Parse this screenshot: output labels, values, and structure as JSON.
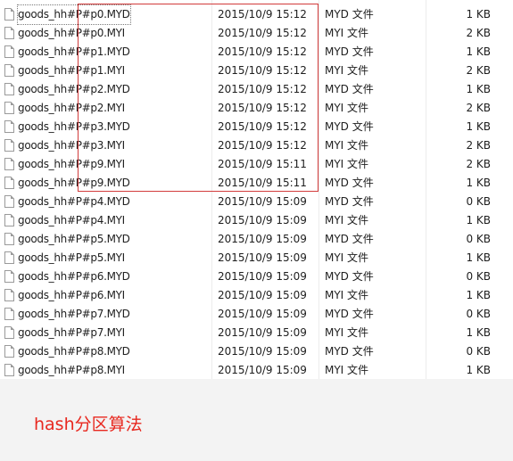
{
  "files": [
    {
      "name": "goods_hh#P#p0.MYD",
      "date": "2015/10/9 15:12",
      "type": "MYD 文件",
      "size": "1 KB"
    },
    {
      "name": "goods_hh#P#p0.MYI",
      "date": "2015/10/9 15:12",
      "type": "MYI 文件",
      "size": "2 KB"
    },
    {
      "name": "goods_hh#P#p1.MYD",
      "date": "2015/10/9 15:12",
      "type": "MYD 文件",
      "size": "1 KB"
    },
    {
      "name": "goods_hh#P#p1.MYI",
      "date": "2015/10/9 15:12",
      "type": "MYI 文件",
      "size": "2 KB"
    },
    {
      "name": "goods_hh#P#p2.MYD",
      "date": "2015/10/9 15:12",
      "type": "MYD 文件",
      "size": "1 KB"
    },
    {
      "name": "goods_hh#P#p2.MYI",
      "date": "2015/10/9 15:12",
      "type": "MYI 文件",
      "size": "2 KB"
    },
    {
      "name": "goods_hh#P#p3.MYD",
      "date": "2015/10/9 15:12",
      "type": "MYD 文件",
      "size": "1 KB"
    },
    {
      "name": "goods_hh#P#p3.MYI",
      "date": "2015/10/9 15:12",
      "type": "MYI 文件",
      "size": "2 KB"
    },
    {
      "name": "goods_hh#P#p9.MYI",
      "date": "2015/10/9 15:11",
      "type": "MYI 文件",
      "size": "2 KB"
    },
    {
      "name": "goods_hh#P#p9.MYD",
      "date": "2015/10/9 15:11",
      "type": "MYD 文件",
      "size": "1 KB"
    },
    {
      "name": "goods_hh#P#p4.MYD",
      "date": "2015/10/9 15:09",
      "type": "MYD 文件",
      "size": "0 KB"
    },
    {
      "name": "goods_hh#P#p4.MYI",
      "date": "2015/10/9 15:09",
      "type": "MYI 文件",
      "size": "1 KB"
    },
    {
      "name": "goods_hh#P#p5.MYD",
      "date": "2015/10/9 15:09",
      "type": "MYD 文件",
      "size": "0 KB"
    },
    {
      "name": "goods_hh#P#p5.MYI",
      "date": "2015/10/9 15:09",
      "type": "MYI 文件",
      "size": "1 KB"
    },
    {
      "name": "goods_hh#P#p6.MYD",
      "date": "2015/10/9 15:09",
      "type": "MYD 文件",
      "size": "0 KB"
    },
    {
      "name": "goods_hh#P#p6.MYI",
      "date": "2015/10/9 15:09",
      "type": "MYI 文件",
      "size": "1 KB"
    },
    {
      "name": "goods_hh#P#p7.MYD",
      "date": "2015/10/9 15:09",
      "type": "MYD 文件",
      "size": "0 KB"
    },
    {
      "name": "goods_hh#P#p7.MYI",
      "date": "2015/10/9 15:09",
      "type": "MYI 文件",
      "size": "1 KB"
    },
    {
      "name": "goods_hh#P#p8.MYD",
      "date": "2015/10/9 15:09",
      "type": "MYD 文件",
      "size": "0 KB"
    },
    {
      "name": "goods_hh#P#p8.MYI",
      "date": "2015/10/9 15:09",
      "type": "MYI 文件",
      "size": "1 KB"
    }
  ],
  "file_icon": "document-file-icon",
  "caption": "hash分区算法",
  "colors": {
    "annotation": "#d23c3c",
    "caption": "#e8281f",
    "footer_background": "#f3f3f3"
  }
}
